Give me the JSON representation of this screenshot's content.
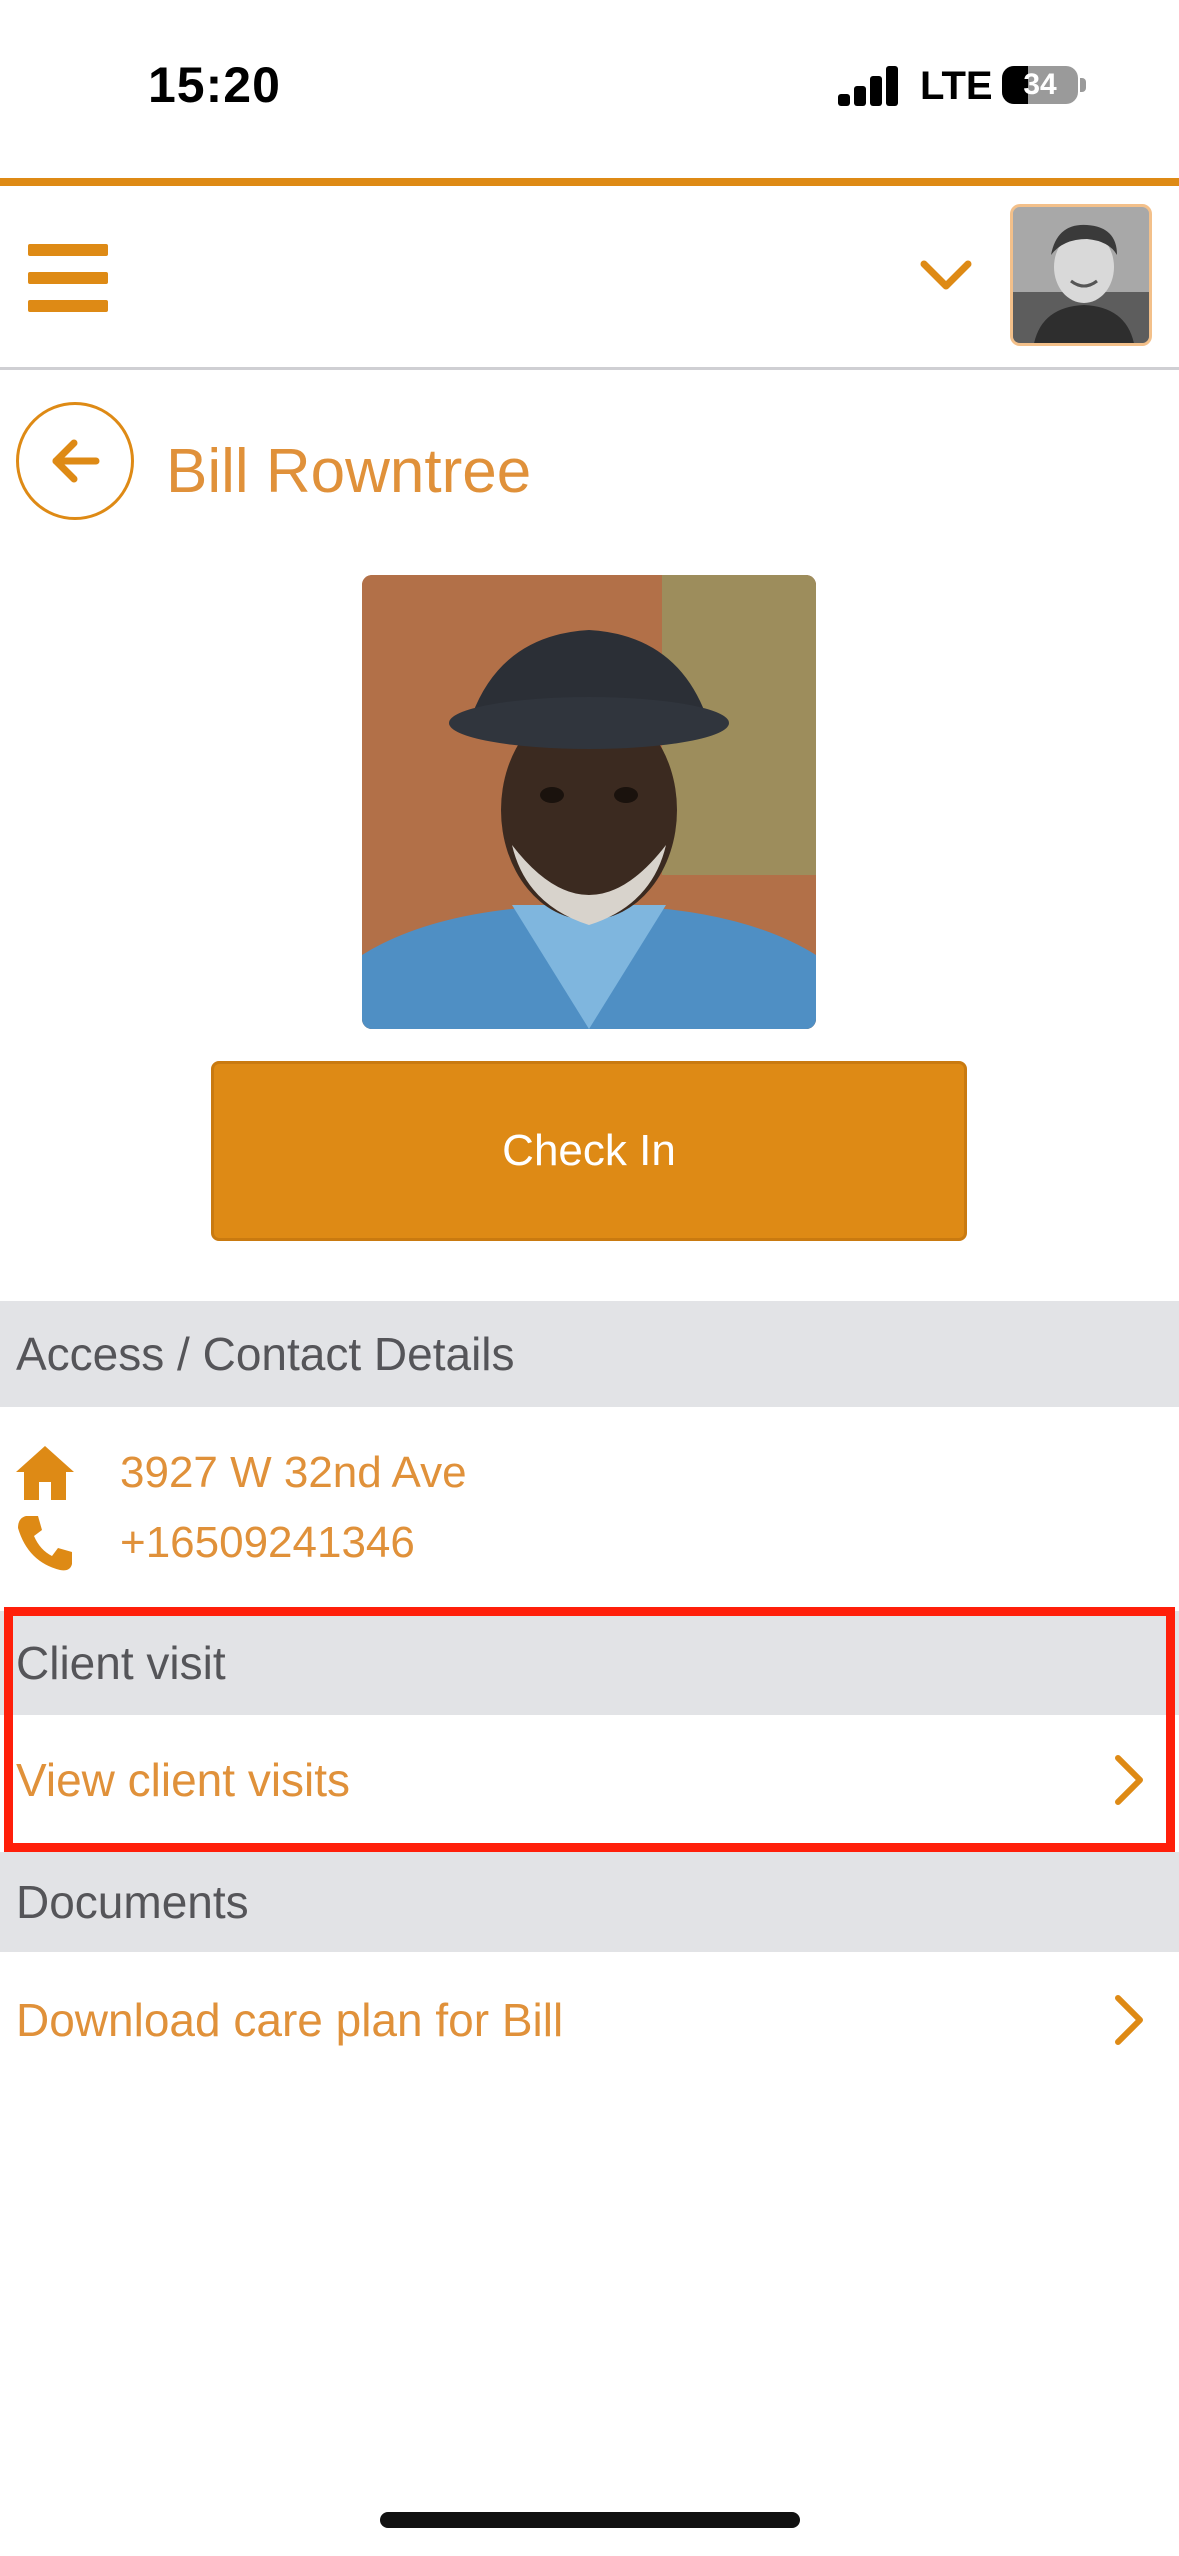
{
  "status_bar": {
    "time": "15:20",
    "network": "LTE",
    "battery": "34",
    "battery_level": 0.34
  },
  "header": {
    "menu_icon": "hamburger-menu-icon",
    "dropdown_icon": "chevron-down-icon",
    "avatar_icon": "user-avatar"
  },
  "client": {
    "name": "Bill Rowntree",
    "check_in_label": "Check In"
  },
  "access_contact": {
    "title": "Access / Contact Details",
    "address": "3927 W 32nd Ave",
    "phone": "+16509241346"
  },
  "client_visit": {
    "title": "Client visit",
    "view_label": "View client visits"
  },
  "documents": {
    "title": "Documents",
    "download_label": "Download care plan for Bill"
  },
  "colors": {
    "accent": "#de8a15",
    "accent_text": "#e0913a",
    "section_bg": "#e2e3e6",
    "highlight": "#ff1f0a"
  }
}
